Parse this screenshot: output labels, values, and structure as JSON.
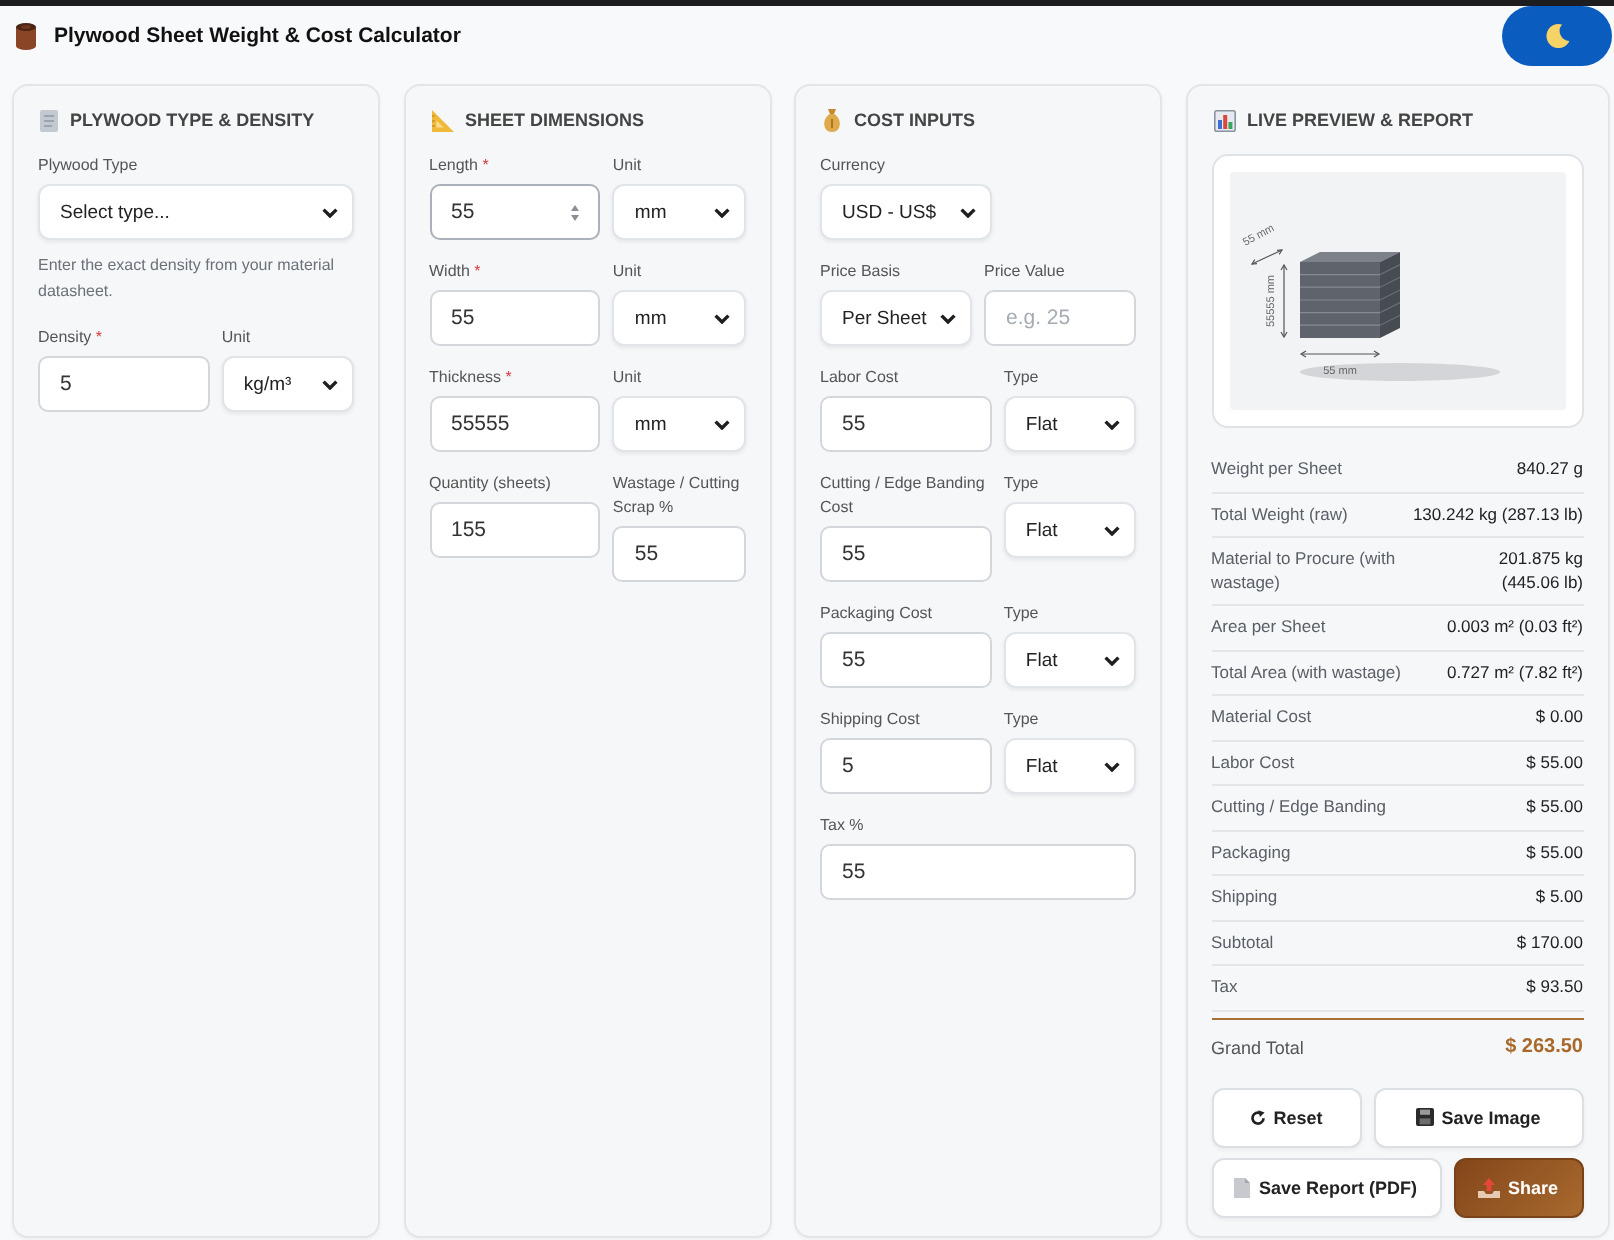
{
  "header": {
    "title": "Plywood Sheet Weight & Cost Calculator"
  },
  "panels": [
    {
      "title": "PLYWOOD TYPE & DENSITY",
      "rows": [
        {
          "kind": "fields",
          "fields": [
            {
              "label": "Plywood Type",
              "kind": "select",
              "value": "Select type...",
              "hovered": false
            }
          ]
        },
        {
          "kind": "note",
          "text": "Enter the exact density from your material datasheet."
        },
        {
          "kind": "fields",
          "fields": [
            {
              "label": "Density",
              "required_mark": "*",
              "kind": "input",
              "value": "5",
              "hovered": false
            },
            {
              "label": "Unit",
              "kind": "select",
              "value": "kg/m³",
              "hovered": false
            }
          ]
        }
      ]
    },
    {
      "title": "SHEET DIMENSIONS",
      "rows": [
        {
          "kind": "fields",
          "fields": [
            {
              "label": "Length",
              "required_mark": "*",
              "kind": "input",
              "value": "55",
              "hovered": true
            },
            {
              "label": "Unit",
              "kind": "select",
              "value": "mm",
              "hovered": false
            }
          ]
        },
        {
          "kind": "fields",
          "fields": [
            {
              "label": "Width",
              "required_mark": "*",
              "kind": "input",
              "value": "55",
              "hovered": false
            },
            {
              "label": "Unit",
              "kind": "select",
              "value": "mm",
              "hovered": false
            }
          ]
        },
        {
          "kind": "fields",
          "fields": [
            {
              "label": "Thickness",
              "required_mark": "*",
              "kind": "input",
              "value": "55555",
              "hovered": false
            },
            {
              "label": "Unit",
              "kind": "select",
              "value": "mm",
              "hovered": false
            }
          ]
        },
        {
          "kind": "fields",
          "fields": [
            {
              "label": "Quantity (sheets)",
              "kind": "input",
              "value": "155",
              "hovered": false
            },
            {
              "label": "Wastage / Cutting Scrap %",
              "kind": "input",
              "value": "55",
              "hovered": false
            }
          ]
        }
      ]
    },
    {
      "title": "COST INPUTS",
      "rows": [
        {
          "kind": "fields",
          "fields": [
            {
              "label": "Currency",
              "kind": "select",
              "value": "USD - US$",
              "hovered": false
            }
          ]
        },
        {
          "kind": "fields",
          "fields": [
            {
              "label": "Price Basis",
              "kind": "select",
              "value": "Per Sheet",
              "hovered": false
            },
            {
              "label": "Price Value",
              "kind": "input",
              "placeholder": "e.g. 25",
              "hovered": false
            }
          ]
        },
        {
          "kind": "fields",
          "fields": [
            {
              "label": "Labor Cost",
              "kind": "input",
              "value": "55",
              "hovered": false
            },
            {
              "label": "Type",
              "kind": "select",
              "value": "Flat",
              "hovered": false
            }
          ]
        },
        {
          "kind": "fields",
          "fields": [
            {
              "label": "Cutting / Edge Banding Cost",
              "kind": "input",
              "value": "55",
              "hovered": false
            },
            {
              "label": "Type",
              "kind": "select",
              "value": "Flat",
              "hovered": false
            }
          ]
        },
        {
          "kind": "fields",
          "fields": [
            {
              "label": "Packaging Cost",
              "kind": "input",
              "value": "55",
              "hovered": false
            },
            {
              "label": "Type",
              "kind": "select",
              "value": "Flat",
              "hovered": false
            }
          ]
        },
        {
          "kind": "fields",
          "fields": [
            {
              "label": "Shipping Cost",
              "kind": "input",
              "value": "5",
              "hovered": false
            },
            {
              "label": "Type",
              "kind": "select",
              "value": "Flat",
              "hovered": false
            }
          ]
        },
        {
          "kind": "fields",
          "fields": [
            {
              "label": "Tax %",
              "kind": "input",
              "value": "55",
              "hovered": false
            }
          ]
        }
      ]
    }
  ],
  "report_panel": {
    "title": "LIVE PREVIEW & REPORT",
    "preview": {
      "depth_label": "55 mm",
      "height_label": "55555 mm",
      "width_label": "55 mm"
    },
    "rows": [
      {
        "label": "Weight per Sheet",
        "value": "840.27 g"
      },
      {
        "label": "Total Weight (raw)",
        "value": "130.242 kg (287.13 lb)"
      },
      {
        "label": "Material to Procure (with wastage)",
        "value": "201.875 kg (445.06 lb)"
      },
      {
        "label": "Area per Sheet",
        "value": "0.003 m² (0.03 ft²)"
      },
      {
        "label": "Total Area (with wastage)",
        "value": "0.727 m² (7.82 ft²)"
      },
      {
        "label": "Material Cost",
        "value": "$ 0.00"
      },
      {
        "label": "Labor Cost",
        "value": "$ 55.00"
      },
      {
        "label": "Cutting / Edge Banding",
        "value": "$ 55.00"
      },
      {
        "label": "Packaging",
        "value": "$ 55.00"
      },
      {
        "label": "Shipping",
        "value": "$ 5.00"
      },
      {
        "label": "Subtotal",
        "value": "$ 170.00"
      },
      {
        "label": "Tax",
        "value": "$ 93.50"
      }
    ],
    "grand_total": {
      "label": "Grand Total",
      "value": "$ 263.50"
    },
    "buttons": [
      {
        "label": "Reset",
        "kind": "reset"
      },
      {
        "label": "Save Image",
        "kind": "save-image"
      },
      {
        "label": "Save Report (PDF)",
        "kind": "save-report"
      },
      {
        "label": "Share",
        "kind": "share"
      }
    ]
  }
}
